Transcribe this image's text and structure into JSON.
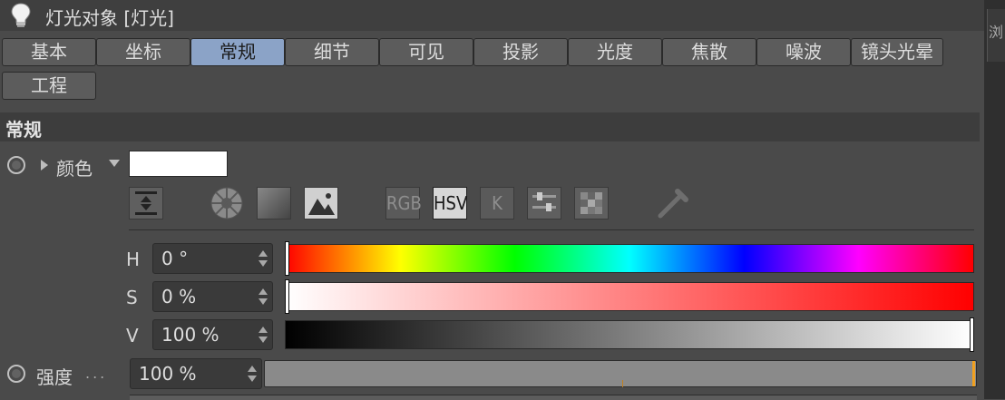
{
  "window": {
    "title": "灯光对象 [灯光]",
    "side_tab": "浏"
  },
  "tabs": [
    {
      "label": "基本",
      "active": false
    },
    {
      "label": "坐标",
      "active": false
    },
    {
      "label": "常规",
      "active": true
    },
    {
      "label": "细节",
      "active": false
    },
    {
      "label": "可见",
      "active": false
    },
    {
      "label": "投影",
      "active": false
    },
    {
      "label": "光度",
      "active": false
    },
    {
      "label": "焦散",
      "active": false
    },
    {
      "label": "噪波",
      "active": false
    },
    {
      "label": "镜头光晕",
      "active": false
    },
    {
      "label": "工程",
      "active": false
    }
  ],
  "section": {
    "title": "常规"
  },
  "color": {
    "label": "颜色",
    "swatch": "#ffffff",
    "toolbar": {
      "rgb": "RGB",
      "hsv": "HSV",
      "k": "K",
      "active_mode": "HSV"
    },
    "h": {
      "label": "H",
      "value": "0 °",
      "fraction": 0.0
    },
    "s": {
      "label": "S",
      "value": "0 %",
      "fraction": 0.0
    },
    "v": {
      "label": "V",
      "value": "100 %",
      "fraction": 1.0
    }
  },
  "intensity": {
    "label": "强度",
    "dots": "...",
    "value": "100 %",
    "fraction": 1.0
  },
  "colors": {
    "accent_tab": "#8ba3c7",
    "slider_marker": "#f0a020"
  }
}
